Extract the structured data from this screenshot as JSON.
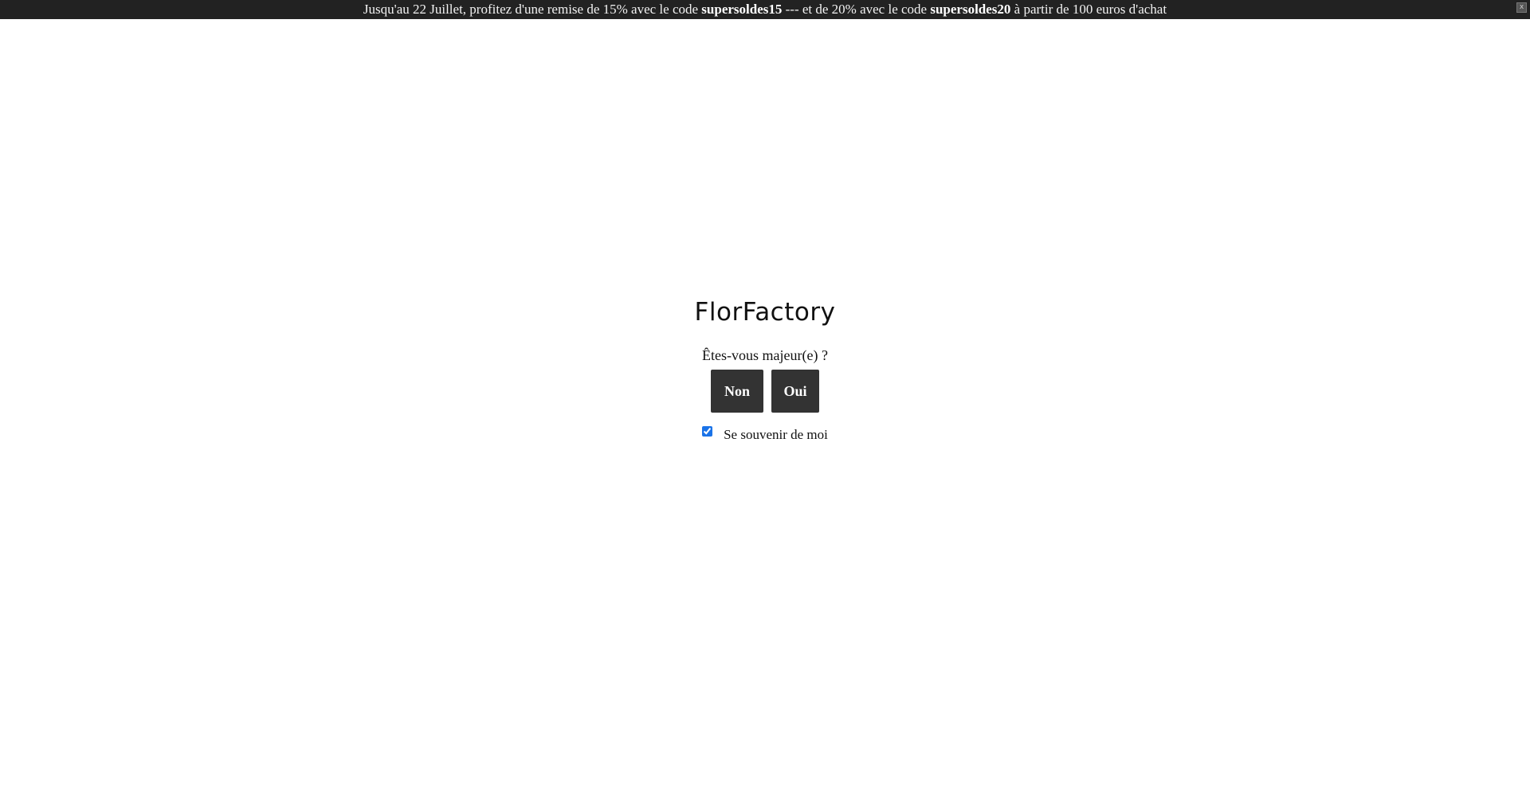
{
  "promo": {
    "text_1": "Jusqu'au 22 Juillet, profitez d'une remise de 15% avec le code ",
    "code_1": "supersoldes15",
    "text_2": " --- et de 20% avec le code ",
    "code_2": "supersoldes20",
    "text_3": " à partir de 100 euros d'achat",
    "close_label": "x"
  },
  "age_gate": {
    "brand": "FlorFactory",
    "question": "Êtes-vous majeur(e) ?",
    "no_label": "Non",
    "yes_label": "Oui",
    "remember_label": "Se souvenir de moi",
    "remember_checked": true
  },
  "colors": {
    "promo_bg": "#222222",
    "button_bg": "#333333",
    "checkbox_accent": "#1a73e8"
  }
}
